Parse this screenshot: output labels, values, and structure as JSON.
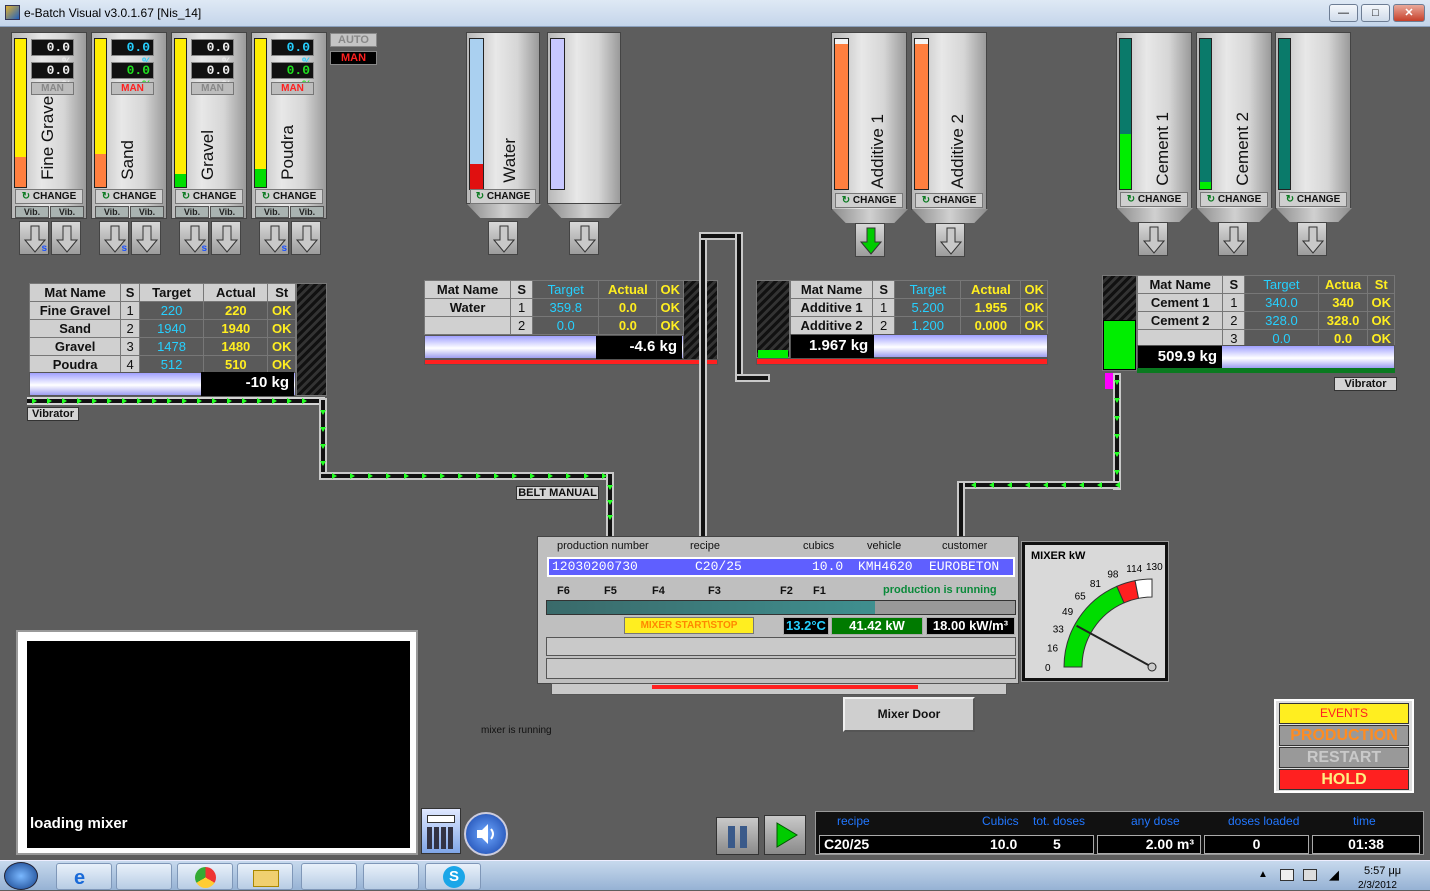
{
  "window": {
    "title": "e-Batch Visual v3.0.1.67 [Nis_14]"
  },
  "colors": {
    "bg": "#5d5d5d",
    "yellow": "#ffee20",
    "cyan": "#26d0ff",
    "green": "#00ee00",
    "red": "#ff2020",
    "orange": "#ff7f3f",
    "teal": "#0a8a7a",
    "blue": "#5f5fff"
  },
  "aggregates": {
    "auto_label": "AUTO",
    "man_label": "MAN",
    "bins": [
      {
        "name": "Fine Gravel",
        "pct1": "0.0 %",
        "pct2": "0.0 %",
        "mode": "MAN",
        "change": "CHANGE",
        "vib1": "Vib.",
        "vib2": "Vib.",
        "fill_pct": 20
      },
      {
        "name": "Sand",
        "pct1": "0.0 %",
        "pct2": "0.0 %",
        "mode": "MAN",
        "change": "CHANGE",
        "vib1": "Vib.",
        "vib2": "Vib.",
        "fill_pct": 22
      },
      {
        "name": "Gravel",
        "pct1": "0.0 %",
        "pct2": "0.0 %",
        "mode": "MAN",
        "change": "CHANGE",
        "vib1": "Vib.",
        "vib2": "Vib.",
        "fill_pct": 9
      },
      {
        "name": "Poudra",
        "pct1": "0.0 %",
        "pct2": "0.0 %",
        "mode": "MAN",
        "change": "CHANGE",
        "vib1": "Vib.",
        "vib2": "Vib.",
        "fill_pct": 12
      }
    ],
    "table": {
      "headers": [
        "Mat Name",
        "S",
        "Target",
        "Actual",
        "St"
      ],
      "rows": [
        {
          "name": "Fine Gravel",
          "s": "1",
          "target": "220",
          "actual": "220",
          "st": "OK"
        },
        {
          "name": "Sand",
          "s": "2",
          "target": "1940",
          "actual": "1940",
          "st": "OK"
        },
        {
          "name": "Gravel",
          "s": "3",
          "target": "1478",
          "actual": "1480",
          "st": "OK"
        },
        {
          "name": "Poudra",
          "s": "4",
          "target": "512",
          "actual": "510",
          "st": "OK"
        }
      ],
      "total": "-10 kg"
    },
    "vibrator": "Vibrator",
    "belt": "BELT MANUAL"
  },
  "water": {
    "bins": [
      {
        "name": "Water",
        "change": "CHANGE",
        "fill_pct": 17
      },
      {
        "name": "",
        "fill_pct": 0
      }
    ],
    "table": {
      "headers": [
        "Mat Name",
        "S",
        "Target",
        "Actual",
        "OK"
      ],
      "rows": [
        {
          "name": "Water",
          "s": "1",
          "target": "359.8",
          "actual": "0.0",
          "st": "OK"
        },
        {
          "name": "",
          "s": "2",
          "target": "0.0",
          "actual": "0.0",
          "st": "OK"
        }
      ],
      "total": "-4.6 kg"
    }
  },
  "additives": {
    "bins": [
      {
        "name": "Additive 1",
        "change": "CHANGE",
        "fill_pct": 97
      },
      {
        "name": "Additive 2",
        "change": "CHANGE",
        "fill_pct": 97
      }
    ],
    "table": {
      "headers": [
        "Mat Name",
        "S",
        "Target",
        "Actual",
        "OK"
      ],
      "rows": [
        {
          "name": "Additive 1",
          "s": "1",
          "target": "5.200",
          "actual": "1.955",
          "st": "OK"
        },
        {
          "name": "Additive 2",
          "s": "2",
          "target": "1.200",
          "actual": "0.000",
          "st": "OK"
        }
      ],
      "total": "1.967 kg"
    }
  },
  "cements": {
    "bins": [
      {
        "name": "Cement 1",
        "change": "CHANGE",
        "fill_pct": 37
      },
      {
        "name": "Cement 2",
        "change": "CHANGE",
        "fill_pct": 5
      },
      {
        "name": "",
        "change": "CHANGE",
        "fill_pct": 0
      }
    ],
    "table": {
      "headers": [
        "Mat Name",
        "S",
        "Target",
        "Actua",
        "St"
      ],
      "rows": [
        {
          "name": "Cement 1",
          "s": "1",
          "target": "340.0",
          "actual": "340",
          "st": "OK"
        },
        {
          "name": "Cement 2",
          "s": "2",
          "target": "328.0",
          "actual": "328.0",
          "st": "OK"
        },
        {
          "name": "",
          "s": "3",
          "target": "0.0",
          "actual": "0.0",
          "st": "OK"
        }
      ],
      "total": "509.9 kg"
    },
    "vibrator": "Vibrator"
  },
  "production": {
    "headers": {
      "number": "production number",
      "recipe": "recipe",
      "cubics": "cubics",
      "vehicle": "vehicle",
      "customer": "customer"
    },
    "number": "12030200730",
    "recipe": "C20/25",
    "cubics": "10.0",
    "vehicle": "KMH4620",
    "customer": "EUROBETON",
    "f_labels": [
      "F6",
      "F5",
      "F4",
      "F3",
      "F2",
      "F1"
    ],
    "status": "production is running",
    "progress_pct": 70,
    "mixer_btn": "MIXER START\\STOP",
    "temp": "13.2°C",
    "kw": "41.42 kW",
    "kwm3": "18.00 kW/m³",
    "mixer_door": "Mixer Door",
    "mixer_status": "mixer is running"
  },
  "gauge": {
    "title": "MIXER kW",
    "ticks": [
      "0",
      "16",
      "33",
      "49",
      "65",
      "81",
      "98",
      "114",
      "130"
    ],
    "value": 41.42,
    "max": 130
  },
  "loading": {
    "text": "loading mixer"
  },
  "right_panel": {
    "events": "EVENTS",
    "production": "PRODUCTION",
    "restart": "RESTART",
    "hold": "HOLD"
  },
  "bottom": {
    "headers": {
      "recipe": "recipe",
      "cubics": "Cubics",
      "tot_doses": "tot. doses",
      "any_dose": "any dose",
      "doses_loaded": "doses loaded",
      "time": "time"
    },
    "recipe": "C20/25",
    "cubics": "10.0",
    "tot_doses": "5",
    "any_dose": "2.00  m³",
    "doses_loaded": "0",
    "time": "01:38"
  },
  "taskbar": {
    "clock": "5:57 μμ",
    "date": "2/3/2012"
  }
}
